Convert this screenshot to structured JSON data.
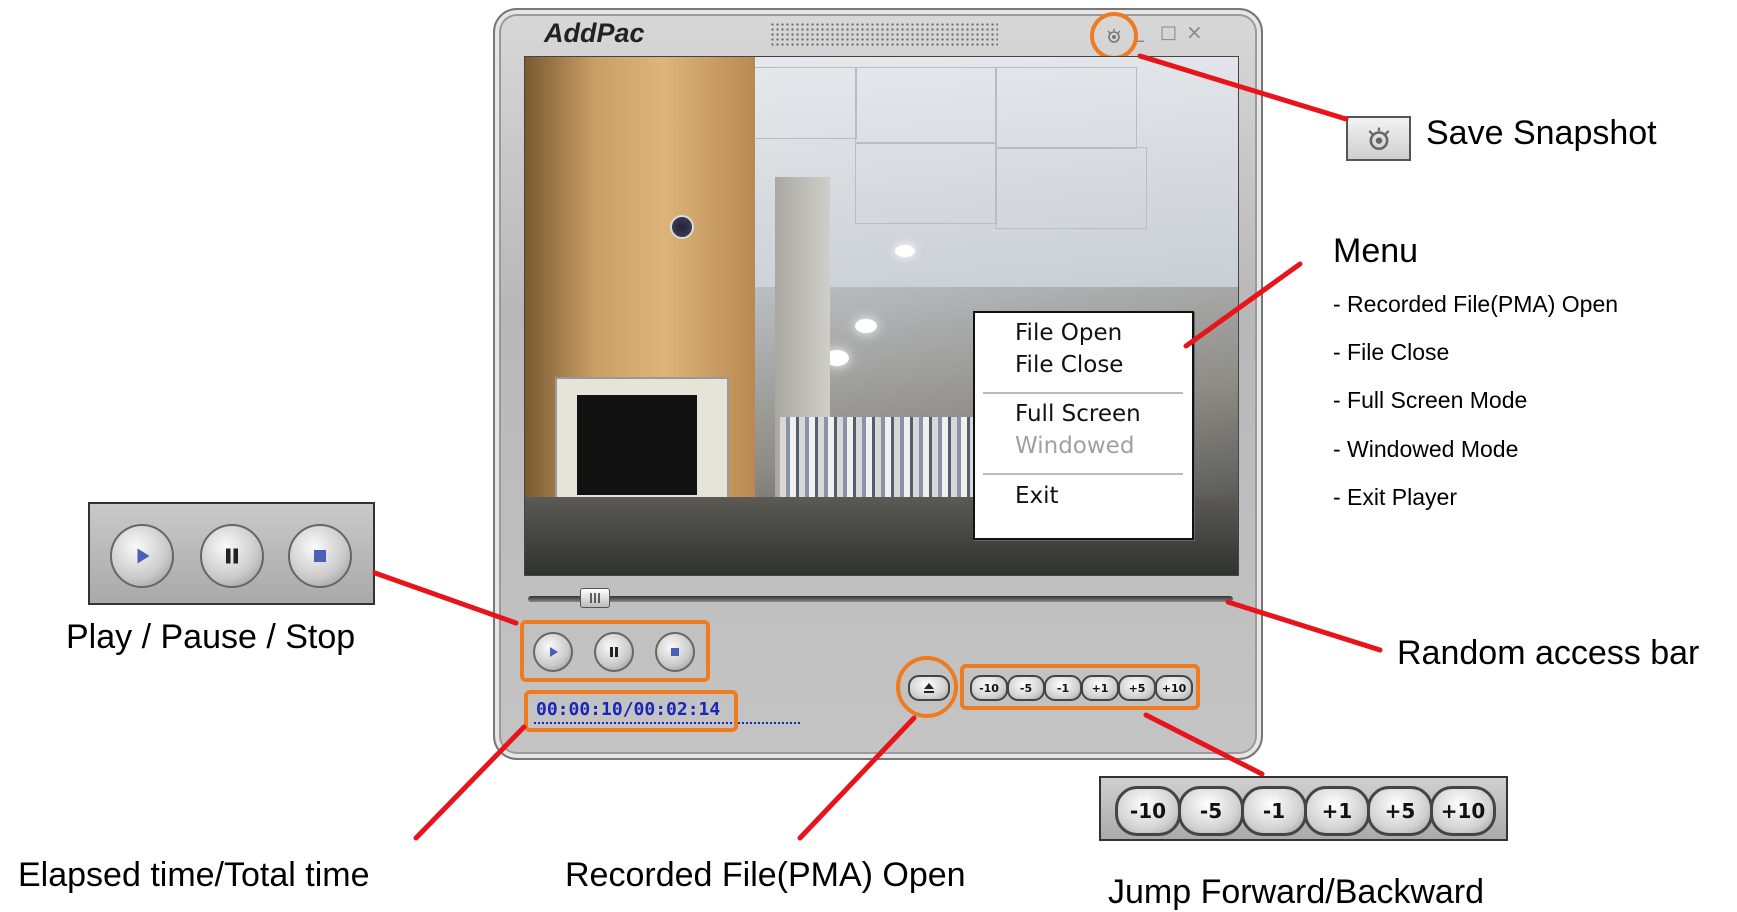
{
  "window": {
    "title": "AddPac",
    "window_controls": [
      "_",
      "□",
      "×"
    ]
  },
  "context_menu": {
    "items": [
      "File Open",
      "File Close",
      "Full Screen",
      "Windowed",
      "Exit"
    ],
    "disabled_item": "Windowed"
  },
  "timer": "00:00:10/00:02:14",
  "jump_buttons": [
    "-10",
    "-5",
    "-1",
    "+1",
    "+5",
    "+10"
  ],
  "callouts": {
    "save_snapshot": "Save Snapshot",
    "menu_heading": "Menu",
    "menu_list": [
      "- Recorded File(PMA) Open",
      "- File Close",
      "- Full Screen Mode",
      "- Windowed Mode",
      "- Exit Player"
    ],
    "play_pause_stop": "Play / Pause / Stop",
    "random_access_bar": "Random access bar",
    "elapsed_total": "Elapsed time/Total time",
    "recorded_file_open": "Recorded File(PMA) Open",
    "jump": "Jump Forward/Backward"
  },
  "colors": {
    "highlight": "#f07a1e",
    "leader_line": "#e8141c",
    "timer_text": "#1a26b8"
  },
  "icons": [
    "snapshot-icon",
    "play-icon",
    "pause-icon",
    "stop-icon",
    "eject-icon"
  ]
}
